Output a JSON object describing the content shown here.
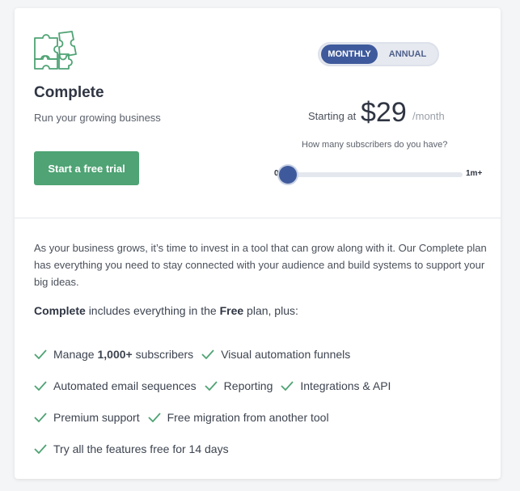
{
  "plan": {
    "name": "Complete",
    "tagline": "Run your growing business",
    "cta_label": "Start a free trial",
    "icon": "puzzle-icon"
  },
  "billing": {
    "monthly_label": "MONTHLY",
    "annual_label": "ANNUAL",
    "selected": "MONTHLY"
  },
  "price": {
    "prefix": "Starting at",
    "amount": "$29",
    "unit": "/month"
  },
  "subscribers": {
    "question": "How many subscribers do you have?",
    "min_label": "0",
    "max_label": "1m+",
    "value_fraction": 0
  },
  "description": "As your business grows, it’s time to invest in a tool that can grow along with it. Our Complete plan has everything you need to stay connected with your audience and build systems to support your big ideas.",
  "includes": {
    "plan": "Complete",
    "mid": "includes everything in the",
    "base_plan": "Free",
    "suffix": "plan, plus:"
  },
  "features": {
    "subs_pre": "Manage",
    "subs_bold": "1,000+",
    "subs_post": "subscribers",
    "items": [
      "Visual automation funnels",
      "Automated email sequences",
      "Reporting",
      "Integrations & API",
      "Premium support",
      "Free migration from another tool",
      "Try all the features free for 14 days"
    ]
  },
  "colors": {
    "accent_green": "#4fa374",
    "toggle_active": "#3f5a9c",
    "check_green": "#4fa374"
  }
}
